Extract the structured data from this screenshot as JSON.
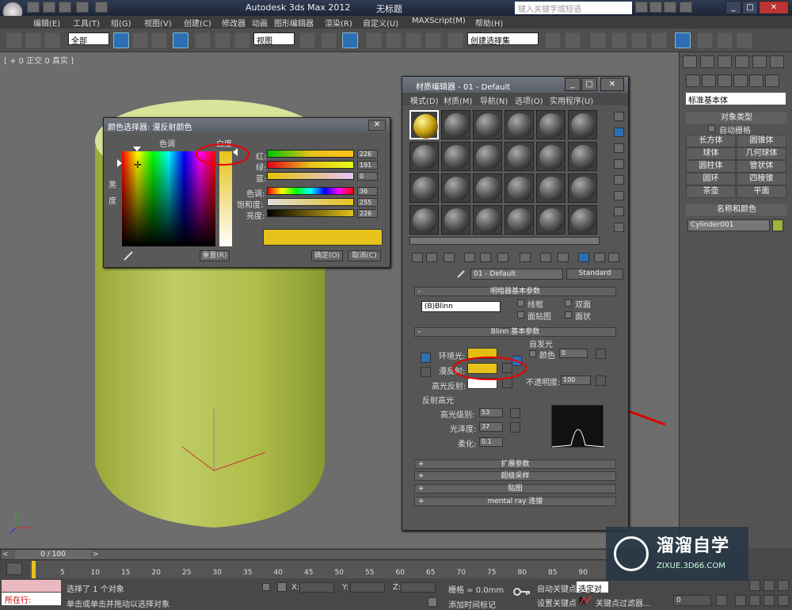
{
  "window": {
    "title": "Autodesk 3ds Max  2012",
    "doc": "无标题",
    "search_placeholder": "键入关键字或短语"
  },
  "menubar": [
    "编辑(E)",
    "工具(T)",
    "组(G)",
    "视图(V)",
    "创建(C)",
    "修改器",
    "动画",
    "图形编辑器",
    "渲染(R)",
    "自定义(U)",
    "MAXScript(M)",
    "帮助(H)"
  ],
  "toolbar": {
    "filter": "全部",
    "refcoord": "视图",
    "selset": "创建选择集"
  },
  "viewport": {
    "label": "[ + 0 正交 0 真实 ]"
  },
  "command_panel": {
    "dropdown": "标准基本体",
    "section_objtype": "对象类型",
    "autogrid": "自动栅格",
    "buttons": [
      "长方体",
      "圆锥体",
      "球体",
      "几何球体",
      "圆柱体",
      "管状体",
      "圆环",
      "四棱锥",
      "茶壶",
      "平面"
    ],
    "section_name": "名称和颜色",
    "object_name": "Cylinder001",
    "object_color": "#a3b43a"
  },
  "color_picker": {
    "title": "颜色选择器: 漫反射颜色",
    "hue_label": "色调",
    "white_label": "白度",
    "black_label": "黑",
    "degree_label": "度",
    "rows": [
      {
        "label": "红:",
        "value": "226",
        "grad": "linear-gradient(to right,#00c200,#e6c21a,#ffc21a)"
      },
      {
        "label": "绿:",
        "value": "191",
        "grad": "linear-gradient(to right,#e60019,#e6c21a,#e6ff1a)"
      },
      {
        "label": "蓝:",
        "value": "0",
        "grad": "linear-gradient(to right,#e6c200,#e6c2ff)"
      },
      {
        "label": "色调:",
        "value": "36",
        "grad": "linear-gradient(to right,red,#ff0,#0f0,#0ff,#00f,#f0f,red)"
      },
      {
        "label": "饱和度:",
        "value": "255",
        "grad": "linear-gradient(to right,#ddd,#e6c21a)"
      },
      {
        "label": "亮度:",
        "value": "226",
        "grad": "linear-gradient(to right,#000,#e6c21a)"
      }
    ],
    "reset": "重置(R)",
    "ok": "确定(O)",
    "cancel": "取消(C)",
    "color": "#e6c21a"
  },
  "material_editor": {
    "title": "材质编辑器 - 01 - Default",
    "menu": [
      "模式(D)",
      "材质(M)",
      "导航(N)",
      "选项(O)",
      "实用程序(U)"
    ],
    "material_name": "01 - Default",
    "material_type": "Standard",
    "rollout_shader": "明暗器基本参数",
    "shader": "(B)Blinn",
    "wire": "线框",
    "twosided": "双面",
    "facemap": "面贴图",
    "faceted": "面状",
    "rollout_blinn": "Blinn 基本参数",
    "self_illum": "自发光",
    "color_chk": "颜色",
    "self_illum_val": "0",
    "ambient": "环境光:",
    "diffuse": "漫反射:",
    "specular": "高光反射:",
    "opacity": "不透明度:",
    "opacity_val": "100",
    "spec_group": "反射高光",
    "spec_level": "高光级别:",
    "spec_level_val": "53",
    "gloss": "光泽度:",
    "gloss_val": "37",
    "soften": "柔化:",
    "soften_val": "0.1",
    "ambient_color": "#e3bf14",
    "diffuse_color": "#e6c21a",
    "specular_color": "#ffffff",
    "rollouts": [
      "扩展参数",
      "超级采样",
      "贴图",
      "mental ray 连接"
    ]
  },
  "timeline": {
    "frame": "0 / 100",
    "ticks": [
      "5",
      "10",
      "15",
      "20",
      "25",
      "30",
      "35",
      "40",
      "45",
      "50",
      "55",
      "60",
      "65",
      "70",
      "75",
      "80",
      "85",
      "90"
    ]
  },
  "status": {
    "running": "所在行:",
    "msg1": "选择了 1 个对象",
    "msg2": "单击或单击并拖动以选择对象",
    "x": "X:",
    "y": "Y:",
    "z": "Z:",
    "grid": "栅格 = 0.0mm",
    "addtime": "添加时间标记",
    "autokey": "自动关键点",
    "setkey": "设置关键点",
    "selobj": "选定对象",
    "keyfilter": "关键点过滤器...",
    "frame_field": "0"
  },
  "watermark": {
    "title": "溜溜自学",
    "url": "ZIXUE.3D66.COM"
  }
}
